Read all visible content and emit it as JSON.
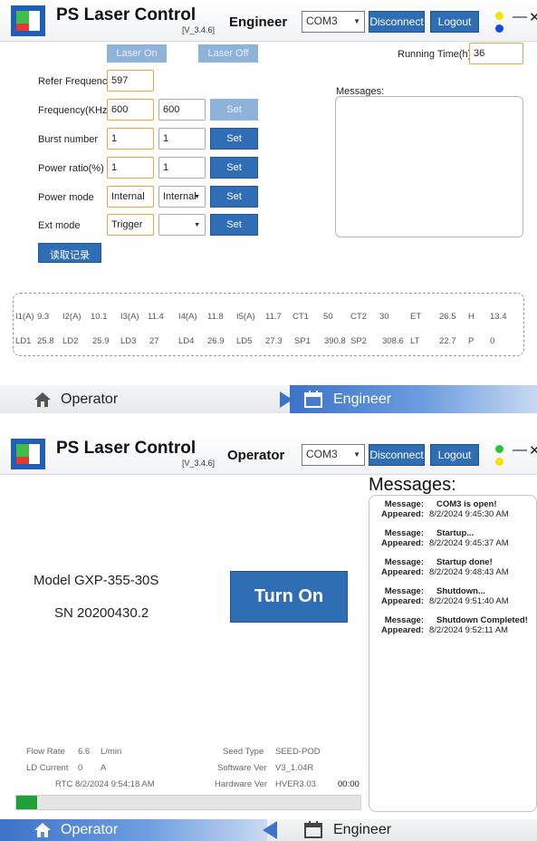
{
  "app": {
    "title": "PS Laser Control",
    "version": "[V_3.4.6]"
  },
  "engineer_view": {
    "header": {
      "role": "Engineer",
      "com_port": "COM3",
      "disconnect_label": "Disconnect",
      "logout_label": "Logout",
      "status_colors": [
        "#f5e400",
        "#1846e0"
      ]
    },
    "laser_on_label": "Laser On",
    "laser_off_label": "Laser Off",
    "running_time_label": "Running Time(h)",
    "running_time_value": "36",
    "messages_label": "Messages:",
    "rows": [
      {
        "label": "Refer Frequency",
        "value1": "597",
        "value2": null,
        "button": null
      },
      {
        "label": "Frequency(KHz)",
        "value1": "600",
        "value2": "600",
        "button": "Set",
        "button_disabled": true
      },
      {
        "label": "Burst number",
        "value1": "1",
        "value2": "1",
        "button": "Set"
      },
      {
        "label": "Power ratio(%)",
        "value1": "1",
        "value2": "1",
        "button": "Set"
      },
      {
        "label": "Power mode",
        "value1": "Internal",
        "value2": "Internal",
        "value2_is_select": true,
        "button": "Set"
      },
      {
        "label": "Ext mode",
        "value1": "Trigger",
        "value2": "",
        "value2_is_select": true,
        "button": "Set"
      }
    ],
    "read_log_label": "读取记录",
    "stats_row1": [
      {
        "label": "I1(A)",
        "value": "9.3"
      },
      {
        "label": "I2(A)",
        "value": "10.1"
      },
      {
        "label": "I3(A)",
        "value": "11.4"
      },
      {
        "label": "I4(A)",
        "value": "11.8"
      },
      {
        "label": "I5(A)",
        "value": "11.7"
      },
      {
        "label": "CT1",
        "value": "50"
      },
      {
        "label": "CT2",
        "value": "30"
      },
      {
        "label": "ET",
        "value": "26.5"
      },
      {
        "label": "H",
        "value": "13.4"
      }
    ],
    "stats_row2": [
      {
        "label": "LD1",
        "value": "25.8"
      },
      {
        "label": "LD2",
        "value": "25.9"
      },
      {
        "label": "LD3",
        "value": "27"
      },
      {
        "label": "LD4",
        "value": "26.9"
      },
      {
        "label": "LD5",
        "value": "27.3"
      },
      {
        "label": "SP1",
        "value": "390.8"
      },
      {
        "label": "SP2",
        "value": "308.6"
      },
      {
        "label": "LT",
        "value": "22.7"
      },
      {
        "label": "P",
        "value": "0"
      }
    ],
    "nav": {
      "operator_label": "Operator",
      "engineer_label": "Engineer",
      "active": "Engineer"
    }
  },
  "operator_view": {
    "header": {
      "role": "Operator",
      "com_port": "COM3",
      "disconnect_label": "Disconnect",
      "logout_label": "Logout",
      "status_colors": [
        "#2bc13a",
        "#f5e400"
      ]
    },
    "model": "Model GXP-355-30S",
    "serial": "SN 20200430.2",
    "turn_on_label": "Turn On",
    "messages_title": "Messages:",
    "message_key_label": "Message:",
    "appeared_key_label": "Appeared:",
    "messages": [
      {
        "message": "COM3 is open!",
        "appeared": "8/2/2024 9:45:30 AM"
      },
      {
        "message": "Startup...",
        "appeared": "8/2/2024 9:45:37 AM"
      },
      {
        "message": "Startup done!",
        "appeared": "8/2/2024 9:48:43 AM"
      },
      {
        "message": "Shutdown...",
        "appeared": "8/2/2024 9:51:40 AM"
      },
      {
        "message": "Shutdown Completed!",
        "appeared": "8/2/2024 9:52:11 AM"
      }
    ],
    "info": {
      "flow_rate_label": "Flow Rate",
      "flow_rate_value": "6.6",
      "flow_rate_unit": "L/min",
      "ld_current_label": "LD Current",
      "ld_current_value": "0",
      "ld_current_unit": "A",
      "rtc_label": "RTC",
      "rtc_value": "8/2/2024 9:54:18 AM",
      "seed_type_label": "Seed Type",
      "seed_type_value": "SEED-POD",
      "software_ver_label": "Software Ver",
      "software_ver_value": "V3_1.04R",
      "hardware_ver_label": "Hardware Ver",
      "hardware_ver_value": "HVER3.03",
      "timer": "00:00"
    },
    "progress": 0.06,
    "nav": {
      "operator_label": "Operator",
      "engineer_label": "Engineer",
      "active": "Operator"
    }
  }
}
